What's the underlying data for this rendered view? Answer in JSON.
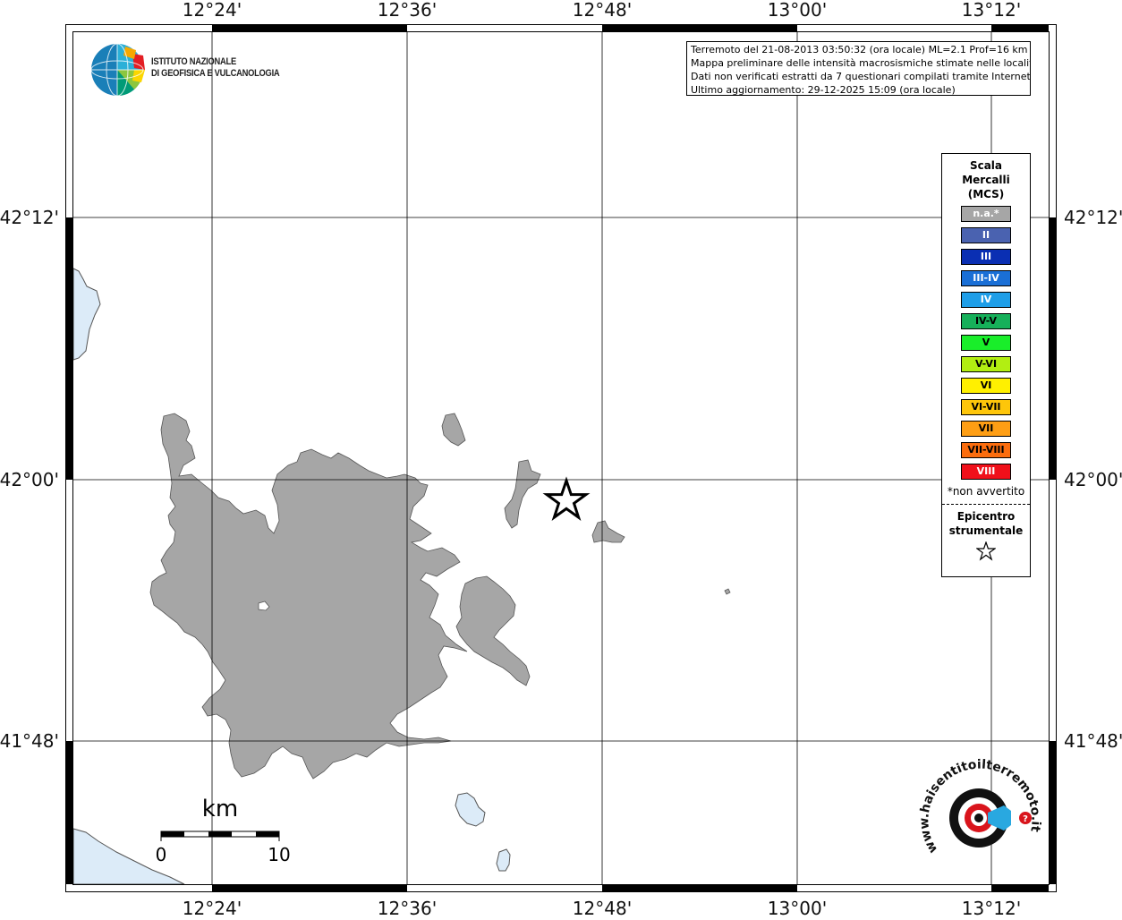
{
  "map": {
    "lon_labels": [
      "12°24'",
      "12°36'",
      "12°48'",
      "13°00'",
      "13°12'"
    ],
    "lat_labels": [
      "42°12'",
      "42°00'",
      "41°48'"
    ]
  },
  "logo_ingv": {
    "line1": "ISTITUTO NAZIONALE",
    "line2": "DI GEOFISICA E VULCANOLOGIA"
  },
  "info": {
    "line1": "Terremoto del 21-08-2013 03:50:32 (ora locale) ML=2.1 Prof=16 km",
    "line2": "Mappa preliminare delle intensità macrosismiche stimate nelle località",
    "line3": "Dati non verificati estratti da 7 questionari compilati tramite Internet.",
    "line4": "Ultimo aggiornamento: 29-12-2025 15:09 (ora locale)"
  },
  "legend": {
    "title_line1": "Scala",
    "title_line2": "Mercalli",
    "title_line3": "(MCS)",
    "items": [
      {
        "label": "n.a.*",
        "color": "#a6a6a6",
        "text_color": "#ffffff"
      },
      {
        "label": "II",
        "color": "#4a62b0",
        "text_color": "#ffffff"
      },
      {
        "label": "III",
        "color": "#0a2fb3",
        "text_color": "#ffffff"
      },
      {
        "label": "III-IV",
        "color": "#1a6fd6",
        "text_color": "#ffffff"
      },
      {
        "label": "IV",
        "color": "#1e9ee8",
        "text_color": "#ffffff"
      },
      {
        "label": "IV-V",
        "color": "#16b05a",
        "text_color": "#000000"
      },
      {
        "label": "V",
        "color": "#19ee2a",
        "text_color": "#000000"
      },
      {
        "label": "V-VI",
        "color": "#b2ee12",
        "text_color": "#000000"
      },
      {
        "label": "VI",
        "color": "#fff000",
        "text_color": "#000000"
      },
      {
        "label": "VI-VII",
        "color": "#fec60a",
        "text_color": "#000000"
      },
      {
        "label": "VII",
        "color": "#fe9e14",
        "text_color": "#000000"
      },
      {
        "label": "VII-VIII",
        "color": "#fb6d0e",
        "text_color": "#000000"
      },
      {
        "label": "VIII",
        "color": "#f0101a",
        "text_color": "#ffffff"
      }
    ],
    "note": "*non avvertito",
    "epicenter_line1": "Epicentro",
    "epicenter_line2": "strumentale"
  },
  "scale_bar": {
    "unit": "km",
    "start": "0",
    "end": "10"
  },
  "hsit_logo": {
    "text": "www.haisentitoilterremoto.it"
  },
  "colors": {
    "urban": "#a6a6a6",
    "water": "#dcebf8",
    "frame": "#000000"
  }
}
